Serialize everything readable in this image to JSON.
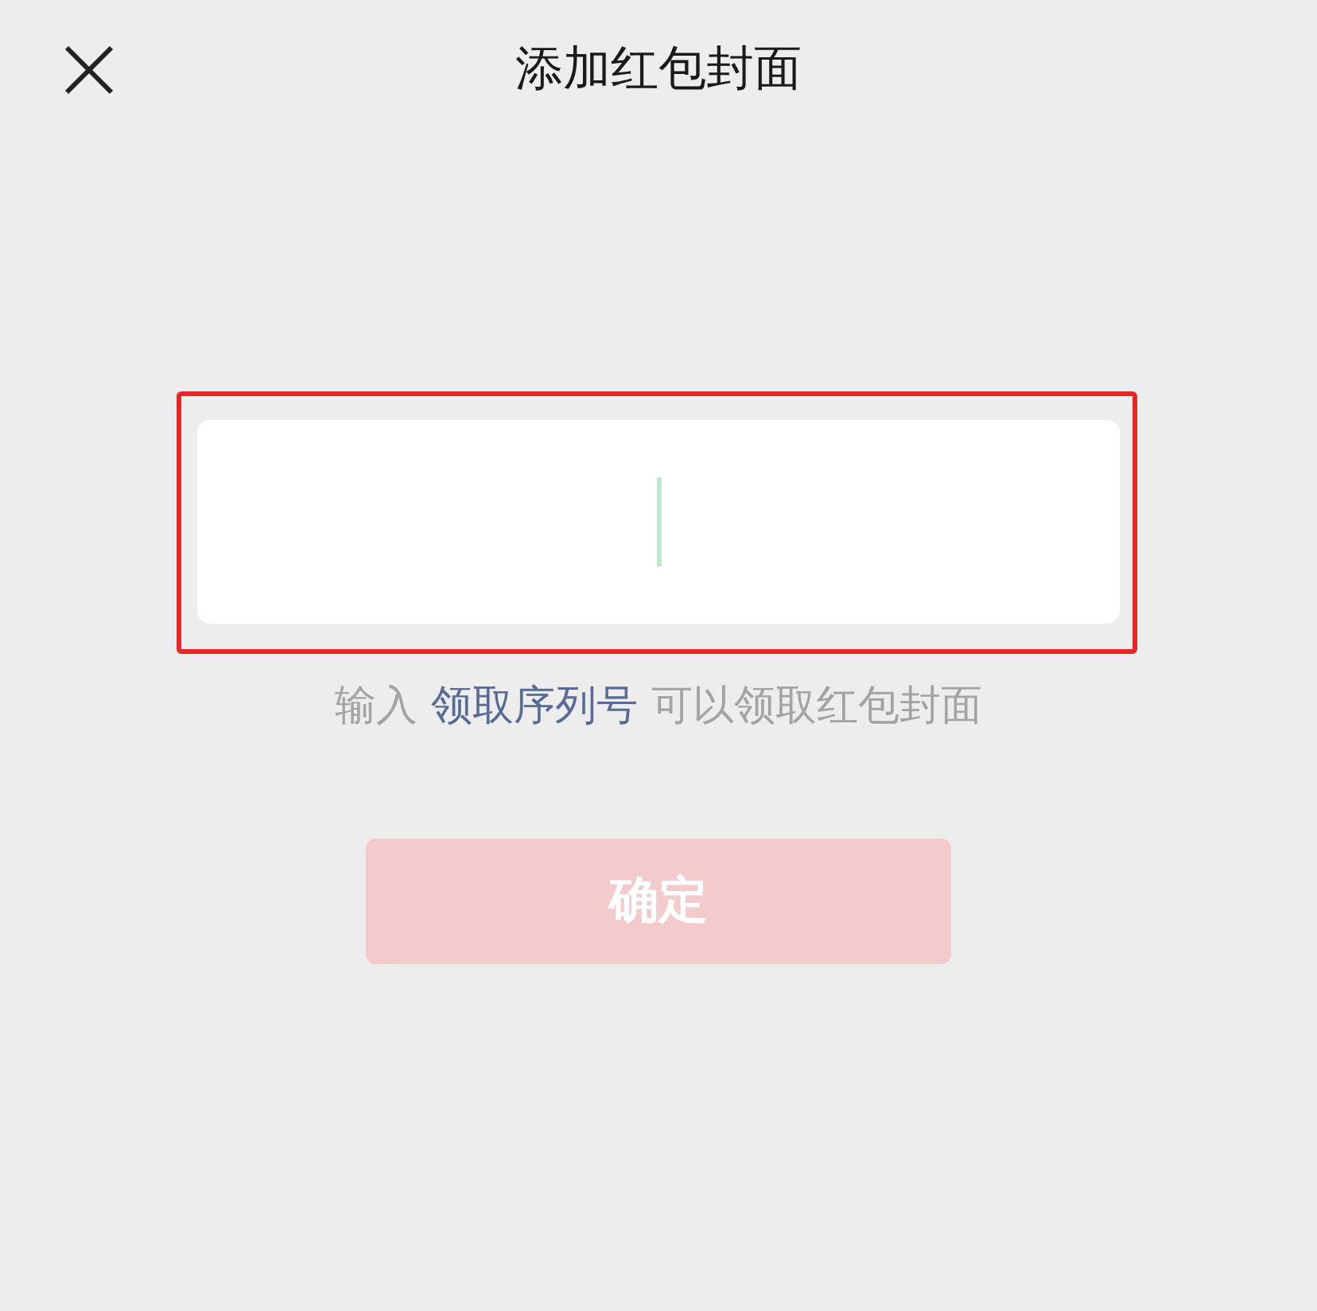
{
  "header": {
    "title": "添加红包封面"
  },
  "serial_field": {
    "focused": true
  },
  "hint": {
    "before": "输入",
    "link": "领取序列号",
    "after": "可以领取红包封面"
  },
  "confirm_button": {
    "label": "确定",
    "disabled": true
  }
}
